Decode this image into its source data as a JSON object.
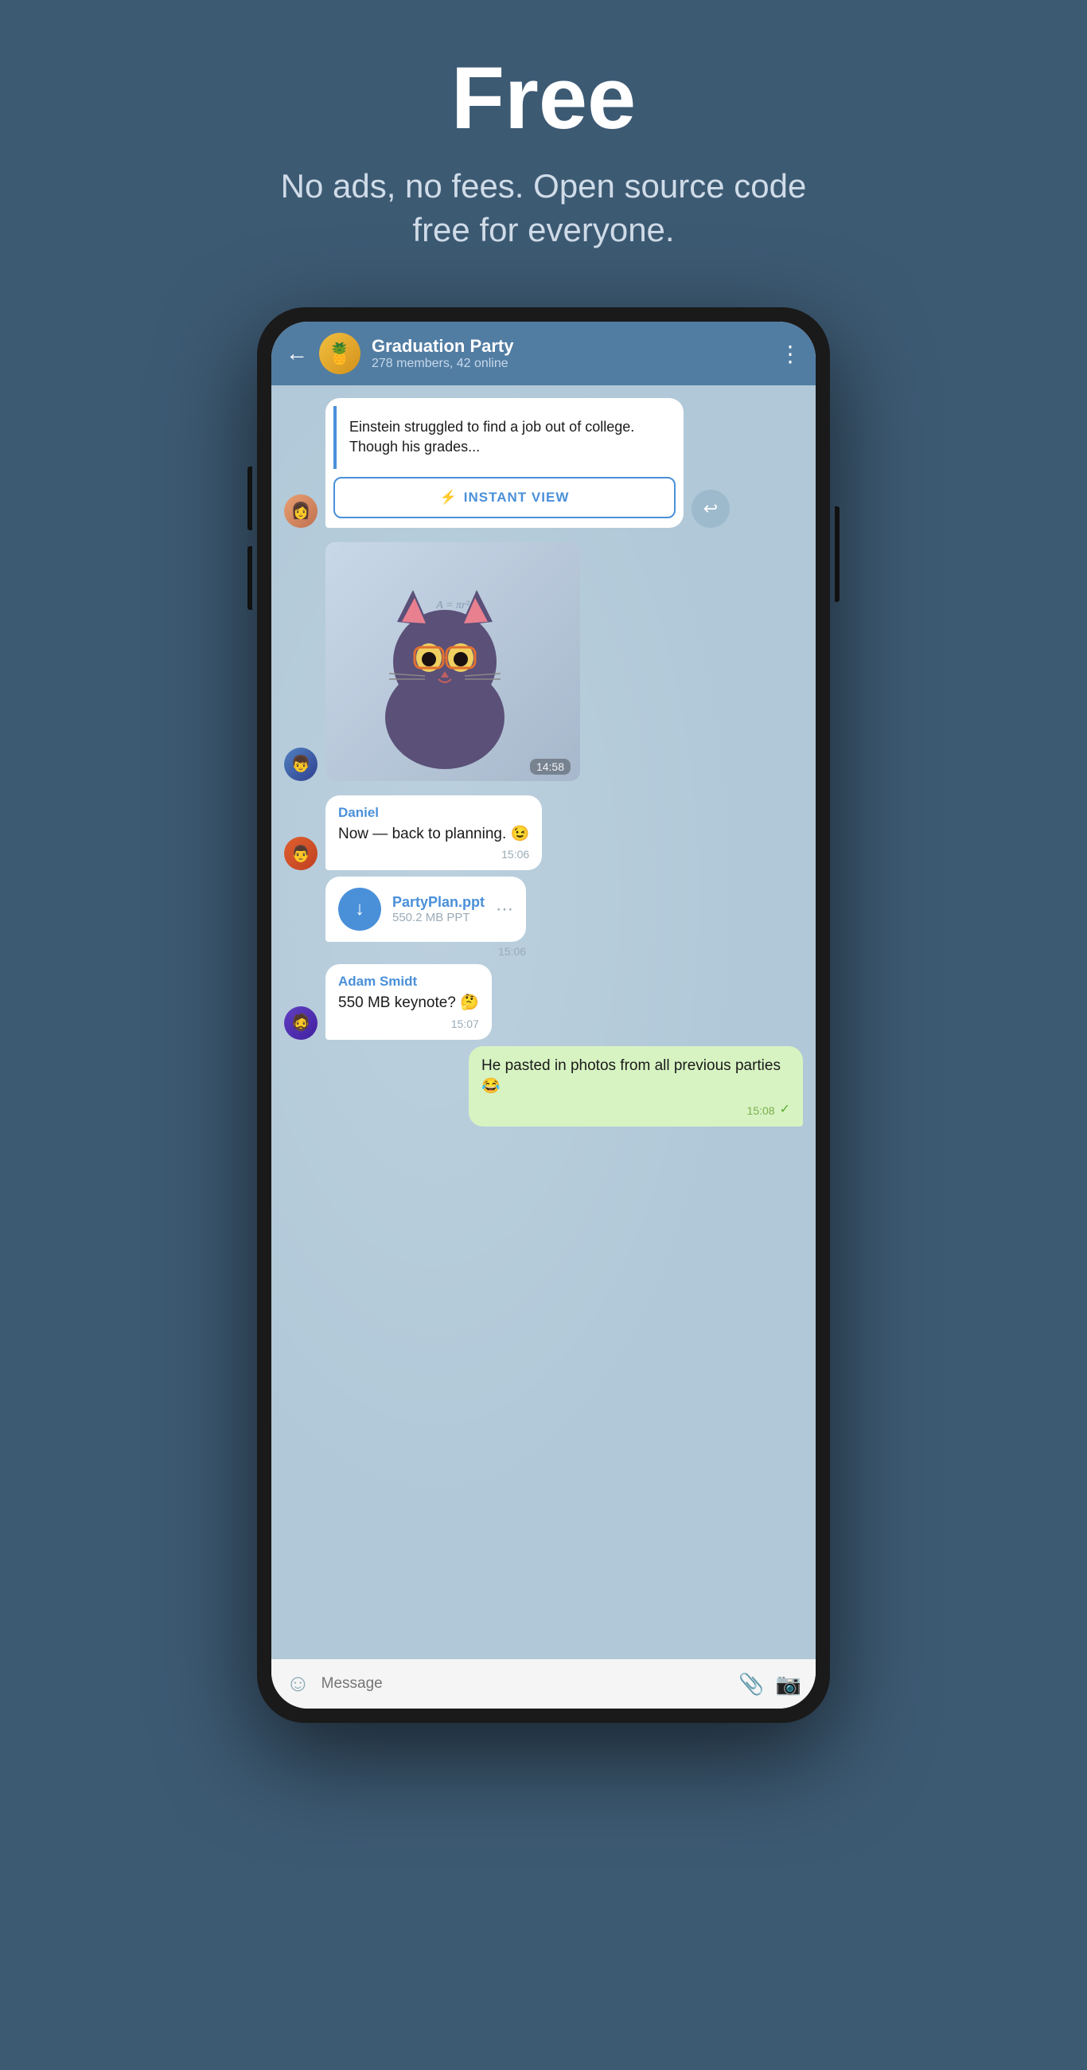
{
  "hero": {
    "title": "Free",
    "subtitle": "No ads, no fees. Open source code free for everyone."
  },
  "chat": {
    "header": {
      "back_label": "←",
      "group_name": "Graduation Party",
      "members_info": "278 members, 42 online",
      "avatar_emoji": "🍍",
      "more_icon": "⋮"
    },
    "messages": [
      {
        "id": "article-msg",
        "type": "article",
        "avatar_emoji": "👩",
        "text": "Einstein struggled to find a job out of college. Though his grades...",
        "instant_view_label": "INSTANT VIEW"
      },
      {
        "id": "sticker-msg",
        "type": "sticker",
        "avatar_emoji": "👦",
        "time": "14:58"
      },
      {
        "id": "daniel-msg",
        "type": "text",
        "avatar_emoji": "👨",
        "sender": "Daniel",
        "text": "Now — back to planning. 😉",
        "time": "15:06"
      },
      {
        "id": "file-msg",
        "type": "file",
        "file_name": "PartyPlan.ppt",
        "file_size": "550.2 MB PPT",
        "time": "15:06"
      },
      {
        "id": "adam-msg",
        "type": "text",
        "avatar_emoji": "🧔",
        "sender": "Adam Smidt",
        "text": "550 MB keynote? 🤔",
        "time": "15:07"
      },
      {
        "id": "sent-msg",
        "type": "sent",
        "text": "He pasted in photos from all previous parties 😂",
        "time": "15:08",
        "read": true
      }
    ]
  },
  "input_bar": {
    "placeholder": "Message"
  },
  "icons": {
    "back": "←",
    "more": "⋮",
    "instant_view_lightning": "⚡",
    "share": "↩",
    "download": "↓",
    "emoji": "☺",
    "attach": "📎",
    "camera": "📷",
    "check": "✓"
  }
}
